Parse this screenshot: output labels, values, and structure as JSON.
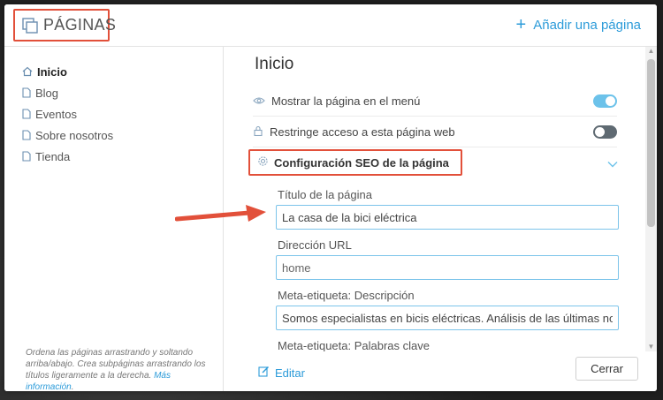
{
  "header": {
    "title": "PÁGINAS",
    "add_page_label": "Añadir una página",
    "title_icon": "pages-icon"
  },
  "sidebar": {
    "items": [
      {
        "label": "Inicio",
        "icon": "home-icon",
        "active": true
      },
      {
        "label": "Blog",
        "icon": "page-icon",
        "active": false
      },
      {
        "label": "Eventos",
        "icon": "page-icon",
        "active": false
      },
      {
        "label": "Sobre nosotros",
        "icon": "page-icon",
        "active": false
      },
      {
        "label": "Tienda",
        "icon": "page-icon",
        "active": false
      }
    ],
    "help_text": "Ordena las páginas arrastrando y soltando arriba/abajo. Crea subpáginas arrastrando los títulos ligeramente a la derecha.",
    "help_link": "Más información"
  },
  "main": {
    "heading": "Inicio",
    "settings": [
      {
        "label": "Mostrar la página en el menú",
        "icon": "eye-icon",
        "enabled": true
      },
      {
        "label": "Restringe acceso a esta página web",
        "icon": "lock-icon",
        "enabled": false
      }
    ],
    "seo": {
      "label": "Configuración SEO de la página",
      "icon": "gear-icon",
      "fields": [
        {
          "label": "Título de la página",
          "value": "La casa de la bici eléctrica"
        },
        {
          "label": "Dirección URL",
          "value": "home"
        },
        {
          "label": "Meta-etiqueta: Descripción",
          "value": "Somos especialistas en bicis eléctricas. Análisis de las últimas nove"
        },
        {
          "label": "Meta-etiqueta: Palabras clave",
          "value": ""
        }
      ]
    }
  },
  "footer": {
    "edit_label": "Editar",
    "close_label": "Cerrar"
  },
  "colors": {
    "accent": "#2c9bd9",
    "annotation": "#e2503a",
    "toggle_on": "#6cc2ea",
    "toggle_off": "#5f6a72"
  }
}
